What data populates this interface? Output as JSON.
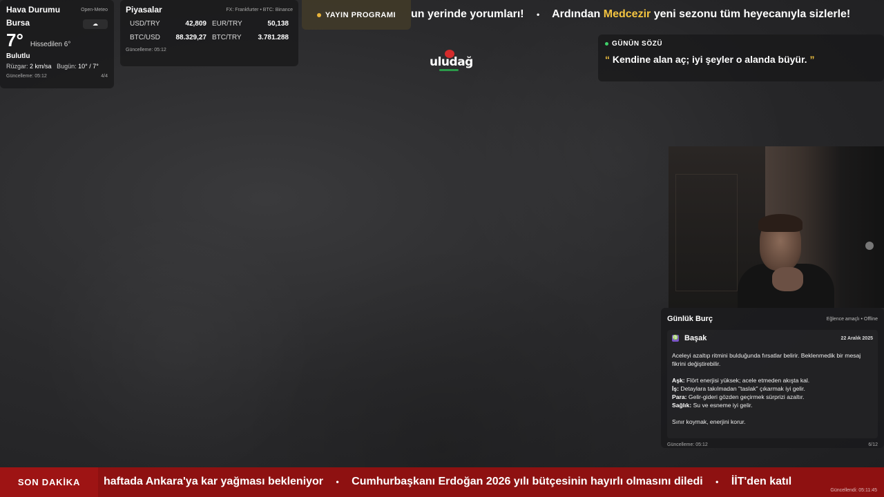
{
  "weather": {
    "title": "Hava Durumu",
    "source": "Open-Meteo",
    "city": "Bursa",
    "icon": "cloud-icon",
    "temperature": "7°",
    "feels_like": "Hissedilen 6°",
    "condition": "Bulutlu",
    "wind_label": "Rüzgar:",
    "wind_value": "2 km/sa",
    "today_label": "Bugün:",
    "today_value": "10° / 7°",
    "updated": "Güncelleme: 05:12",
    "page": "4/4"
  },
  "markets": {
    "title": "Piyasalar",
    "source": "FX: Frankfurter • BTC: Binance",
    "items": [
      {
        "label": "USD/TRY",
        "value": "42,809"
      },
      {
        "label": "EUR/TRY",
        "value": "50,138"
      },
      {
        "label": "BTC/USD",
        "value": "88.329,27"
      },
      {
        "label": "BTC/TRY",
        "value": "3.781.288"
      }
    ],
    "updated": "Güncelleme: 05:12"
  },
  "program": {
    "label": "YAYIN PROGRAMI"
  },
  "top_ticker": {
    "segment1": "un yerinde yorumları!",
    "segment2_pre": "Ardından",
    "segment2_highlight": "Medcezir",
    "segment2_post": "yeni sezonu tüm heyecanıyla sizlerle!",
    "separator": "•"
  },
  "logo": {
    "text": "uludağ"
  },
  "quote": {
    "label": "GÜNÜN SÖZÜ",
    "open_mark": "“",
    "text": "Kendine alan aç; iyi şeyler o alanda büyür.",
    "close_mark": "”"
  },
  "horoscope": {
    "title": "Günlük Burç",
    "note": "Eğlence amaçlı • Offline",
    "sign": "Başak",
    "sign_symbol": "♍",
    "date": "22 Aralık 2025",
    "intro": "Aceleyi azaltıp ritmini bulduğunda fırsatlar belirir. Beklenmedik bir mesaj fikrini değiştirebilir.",
    "ask_label": "Aşk:",
    "ask_text": "Flört enerjisi yüksek; acele etmeden akışta kal.",
    "is_label": "İş:",
    "is_text": "Detaylara takılmadan \"taslak\" çıkarmak iyi gelir.",
    "para_label": "Para:",
    "para_text": "Gelir-gideri gözden geçirmek sürprizi azaltır.",
    "saglik_label": "Sağlık:",
    "saglik_text": "Su ve esneme iyi gelir.",
    "closing": "Sınır koymak, enerjini korur.",
    "updated": "Güncelleme: 05:12",
    "page": "6/12"
  },
  "breaking": {
    "label": "SON DAKİKA",
    "item1": "haftada Ankara'ya kar yağması bekleniyor",
    "item2": "Cumhurbaşkanı Erdoğan 2026 yılı bütçesinin hayırlı olmasını diledi",
    "item3": "İİT'den katıl",
    "separator": "•",
    "updated": "Güncellendi: 05:11:45"
  },
  "colors": {
    "accent_yellow": "#f4c440",
    "breaking_red": "#8e1111",
    "live_green": "#3fd06a"
  }
}
